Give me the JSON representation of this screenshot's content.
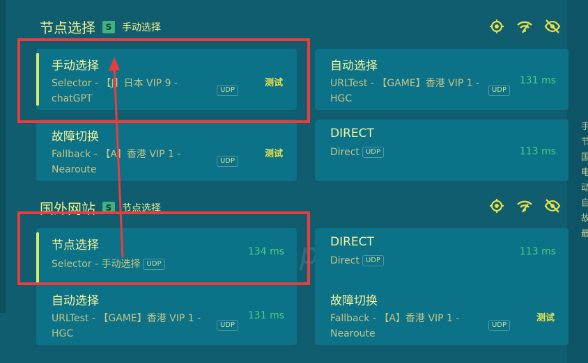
{
  "groups": [
    {
      "title": "节点选择",
      "badge": "S",
      "selected": "手动选择",
      "cards": [
        {
          "name": "手动选择",
          "sub": "Selector - 【J】日本 VIP 9 - chatGPT",
          "udp": "UDP",
          "status": "测试",
          "active": true
        },
        {
          "name": "自动选择",
          "sub": "URLTest - 【GAME】香港 VIP 1 - HGC",
          "udp": "UDP",
          "status": "131 ms",
          "active": false
        },
        {
          "name": "故障切换",
          "sub": "Fallback - 【A】香港 VIP 1 - Nearoute",
          "udp": "UDP",
          "status": "测试",
          "active": false
        },
        {
          "name": "DIRECT",
          "sub": "Direct",
          "udp": "UDP",
          "status": "113 ms",
          "active": false
        }
      ]
    },
    {
      "title": "国外网站",
      "badge": "S",
      "selected": "节点选择",
      "cards": [
        {
          "name": "节点选择",
          "sub": "Selector - 手动选择",
          "udp": "UDP",
          "status": "134 ms",
          "active": true
        },
        {
          "name": "DIRECT",
          "sub": "Direct",
          "udp": "UDP",
          "status": "113 ms",
          "active": false
        },
        {
          "name": "自动选择",
          "sub": "URLTest - 【GAME】香港 VIP 1 - HGC",
          "udp": "UDP",
          "status": "131 ms",
          "active": false
        },
        {
          "name": "故障切换",
          "sub": "Fallback - 【A】香港 VIP 1 - Nearoute",
          "udp": "UDP",
          "status": "测试",
          "active": false
        }
      ]
    }
  ],
  "side_text": [
    "手",
    "节",
    "国",
    "电",
    "动",
    "自",
    "故",
    "最"
  ],
  "icons": [
    "location-icon",
    "wifi-speed-icon",
    "eye-off-icon"
  ],
  "colors": {
    "accent": "#d8ea6a",
    "latency": "#4ed07e",
    "test": "#e6e14a",
    "annotation": "#ee3b3b"
  }
}
